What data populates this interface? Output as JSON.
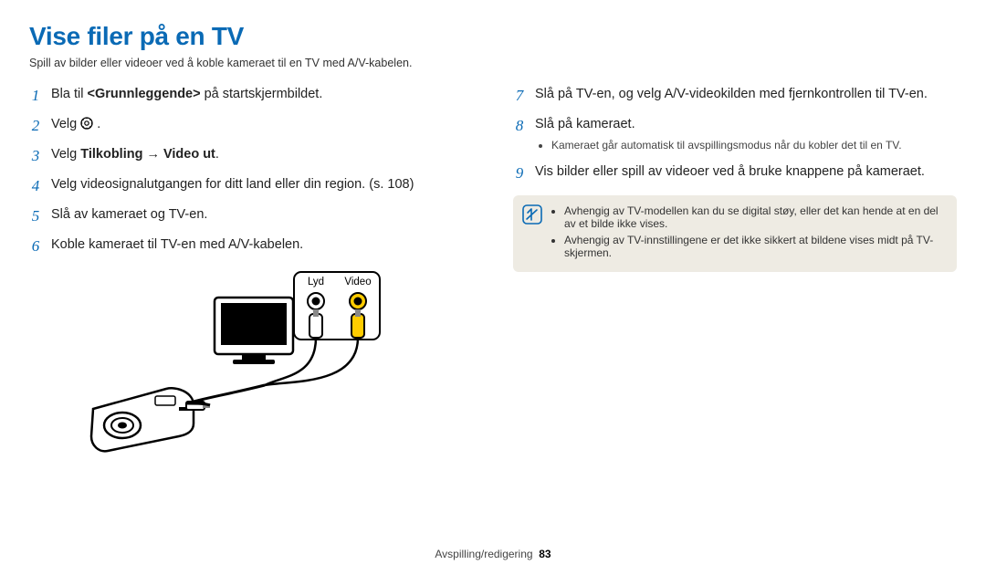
{
  "title": "Vise filer på en TV",
  "subtitle": "Spill av bilder eller videoer ved å koble kameraet til en TV med A/V-kabelen.",
  "left_steps": [
    {
      "n": "1",
      "parts": [
        "Bla til ",
        {
          "bold": "<Grunnleggende>"
        },
        " på startskjermbildet."
      ]
    },
    {
      "n": "2",
      "parts": [
        "Velg ",
        {
          "icon": "settings"
        },
        " ."
      ]
    },
    {
      "n": "3",
      "parts": [
        "Velg ",
        {
          "bold": "Tilkobling"
        },
        {
          "arrow": "→"
        },
        {
          "bold": "Video ut"
        },
        "."
      ]
    },
    {
      "n": "4",
      "parts": [
        "Velg videosignalutgangen for ditt land eller din region. (s. 108)"
      ]
    },
    {
      "n": "5",
      "parts": [
        "Slå av kameraet og TV-en."
      ]
    },
    {
      "n": "6",
      "parts": [
        "Koble kameraet til TV-en med A/V-kabelen."
      ]
    }
  ],
  "right_steps": [
    {
      "n": "7",
      "parts": [
        "Slå på TV-en, og velg A/V-videokilden med fjernkontrollen til TV-en."
      ]
    },
    {
      "n": "8",
      "parts": [
        "Slå på kameraet."
      ],
      "sub": [
        "Kameraet går automatisk til avspillingsmodus når du kobler det til en TV."
      ]
    },
    {
      "n": "9",
      "parts": [
        "Vis bilder eller spill av videoer ved å bruke knappene på kameraet."
      ]
    }
  ],
  "diagram": {
    "audio_label": "Lyd",
    "video_label": "Video"
  },
  "notes": [
    "Avhengig av TV-modellen kan du se digital støy, eller det kan hende at en del av et bilde ikke vises.",
    "Avhengig av TV-innstillingene er det ikke sikkert at bildene vises midt på TV-skjermen."
  ],
  "footer": {
    "section": "Avspilling/redigering",
    "page": "83"
  }
}
